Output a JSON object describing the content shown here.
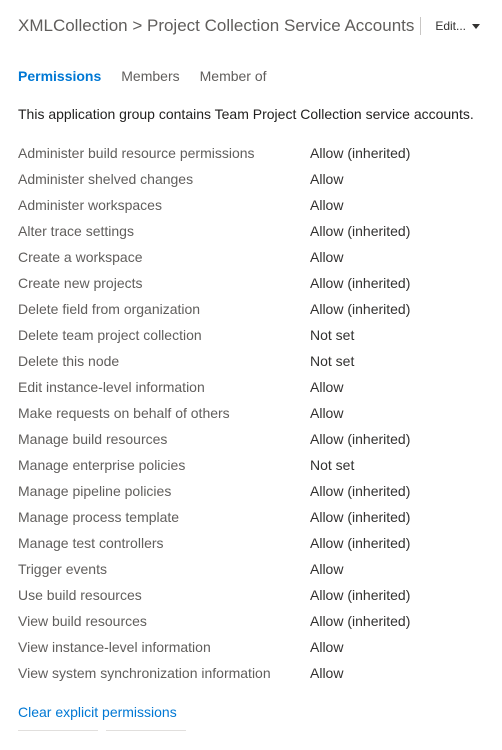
{
  "header": {
    "breadcrumb": "XMLCollection > Project Collection Service Accounts",
    "edit_label": "Edit..."
  },
  "tabs": [
    {
      "label": "Permissions",
      "active": true
    },
    {
      "label": "Members",
      "active": false
    },
    {
      "label": "Member of",
      "active": false
    }
  ],
  "description": "This application group contains Team Project Collection service accounts.",
  "permissions": [
    {
      "name": "Administer build resource permissions",
      "value": "Allow (inherited)"
    },
    {
      "name": "Administer shelved changes",
      "value": "Allow"
    },
    {
      "name": "Administer workspaces",
      "value": "Allow"
    },
    {
      "name": "Alter trace settings",
      "value": "Allow (inherited)"
    },
    {
      "name": "Create a workspace",
      "value": "Allow"
    },
    {
      "name": "Create new projects",
      "value": "Allow (inherited)"
    },
    {
      "name": "Delete field from organization",
      "value": "Allow (inherited)"
    },
    {
      "name": "Delete team project collection",
      "value": "Not set"
    },
    {
      "name": "Delete this node",
      "value": "Not set"
    },
    {
      "name": "Edit instance-level information",
      "value": "Allow"
    },
    {
      "name": "Make requests on behalf of others",
      "value": "Allow"
    },
    {
      "name": "Manage build resources",
      "value": "Allow (inherited)"
    },
    {
      "name": "Manage enterprise policies",
      "value": "Not set"
    },
    {
      "name": "Manage pipeline policies",
      "value": "Allow (inherited)"
    },
    {
      "name": "Manage process template",
      "value": "Allow (inherited)"
    },
    {
      "name": "Manage test controllers",
      "value": "Allow (inherited)"
    },
    {
      "name": "Trigger events",
      "value": "Allow"
    },
    {
      "name": "Use build resources",
      "value": "Allow (inherited)"
    },
    {
      "name": "View build resources",
      "value": "Allow (inherited)"
    },
    {
      "name": "View instance-level information",
      "value": "Allow"
    },
    {
      "name": "View system synchronization information",
      "value": "Allow"
    }
  ],
  "clear_link": "Clear explicit permissions"
}
